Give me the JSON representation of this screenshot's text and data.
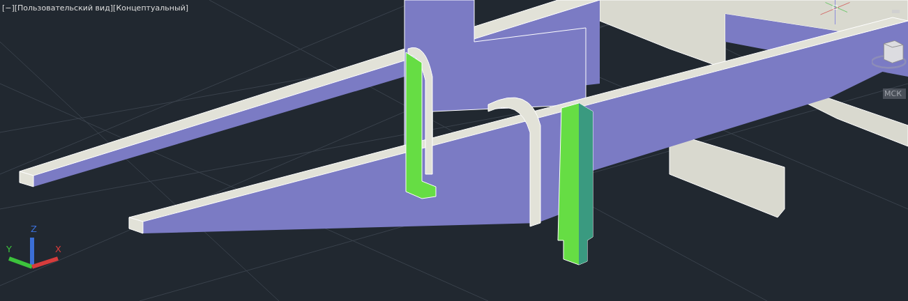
{
  "viewport": {
    "label": "[−][Пользовательский вид][Концептуальный]",
    "wcs_label": "МСК"
  },
  "ucs_icon": {
    "axes": [
      {
        "kind": "z",
        "label": "Z"
      },
      {
        "kind": "y",
        "label": "Y"
      },
      {
        "kind": "x",
        "label": "X"
      }
    ]
  }
}
